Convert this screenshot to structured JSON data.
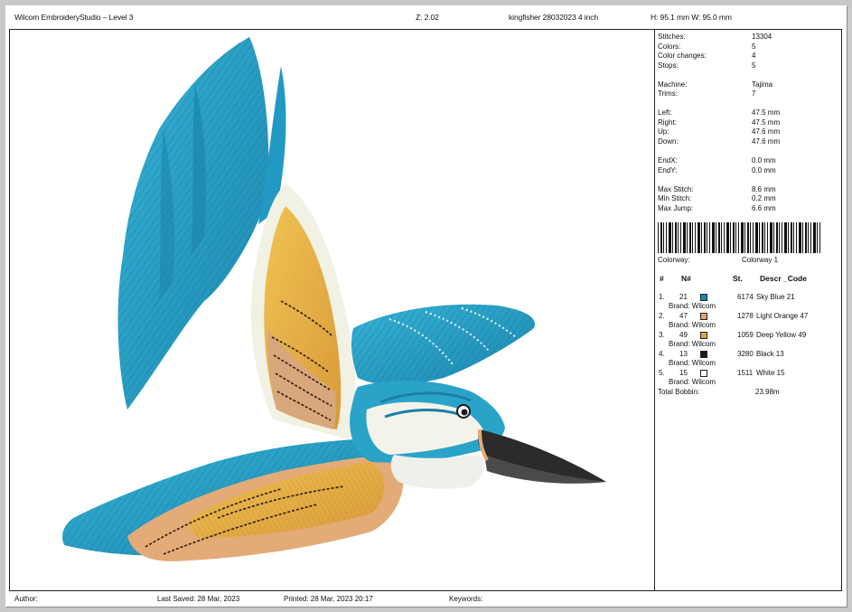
{
  "header": {
    "app_title": "Wilcom EmbroideryStudio – Level 3",
    "zoom": "Z: 2.02",
    "design_name": "kingfisher 28032023 4 inch",
    "dimensions": "H: 95.1 mm   W: 95.0 mm"
  },
  "stats": [
    {
      "label": "Stitches:",
      "value": "13304"
    },
    {
      "label": "Colors:",
      "value": "5"
    },
    {
      "label": "Color changes:",
      "value": "4"
    },
    {
      "label": "Stops:",
      "value": "5"
    },
    {
      "label": "Machine:",
      "value": "Tajima"
    },
    {
      "label": "Trims:",
      "value": "7"
    },
    {
      "label": "Left:",
      "value": "47.5 mm"
    },
    {
      "label": "Right:",
      "value": "47.5 mm"
    },
    {
      "label": "Up:",
      "value": "47.6 mm"
    },
    {
      "label": "Down:",
      "value": "47.6 mm"
    },
    {
      "label": "EndX:",
      "value": "0.0 mm"
    },
    {
      "label": "EndY:",
      "value": "0.0 mm"
    },
    {
      "label": "Max Stitch:",
      "value": "8.6 mm"
    },
    {
      "label": "Min Stitch:",
      "value": "0.2 mm"
    },
    {
      "label": "Max Jump:",
      "value": "6.6 mm"
    }
  ],
  "colorway": {
    "label": "Colorway:",
    "value": "Colorway 1"
  },
  "table": {
    "headers": {
      "idx": "#",
      "n": "N#",
      "st": "St.",
      "descr": "Descr _Code"
    },
    "brand_label": "Brand: Wilcom",
    "rows": [
      {
        "idx": "1.",
        "n": "21",
        "color": "#1a84b8",
        "st": "6174",
        "descr": "Sky Blue 21"
      },
      {
        "idx": "2.",
        "n": "47",
        "color": "#e1a267",
        "st": "1278",
        "descr": "Light Orange 47"
      },
      {
        "idx": "3.",
        "n": "49",
        "color": "#d9a845",
        "st": "1059",
        "descr": "Deep Yellow 49"
      },
      {
        "idx": "4.",
        "n": "13",
        "color": "#1a1a1a",
        "st": "3280",
        "descr": "Black 13"
      },
      {
        "idx": "5.",
        "n": "15",
        "color": "#ffffff",
        "st": "1511",
        "descr": "White 15"
      }
    ],
    "total_label": "Total Bobbin:",
    "total_value": "23.98m"
  },
  "footer": {
    "author": "Author:",
    "last_saved": "Last Saved: 28 Mar, 2023",
    "printed": "Printed: 28 Mar, 2023 20:17",
    "keywords": "Keywords:"
  },
  "colors": {
    "sky_blue": "#2aa3c9",
    "sky_blue_dark": "#1b7fa6",
    "light_orange": "#e0ab7a",
    "deep_yellow": "#e0a93c",
    "black": "#1a1a1a",
    "white": "#f4f4ee"
  }
}
